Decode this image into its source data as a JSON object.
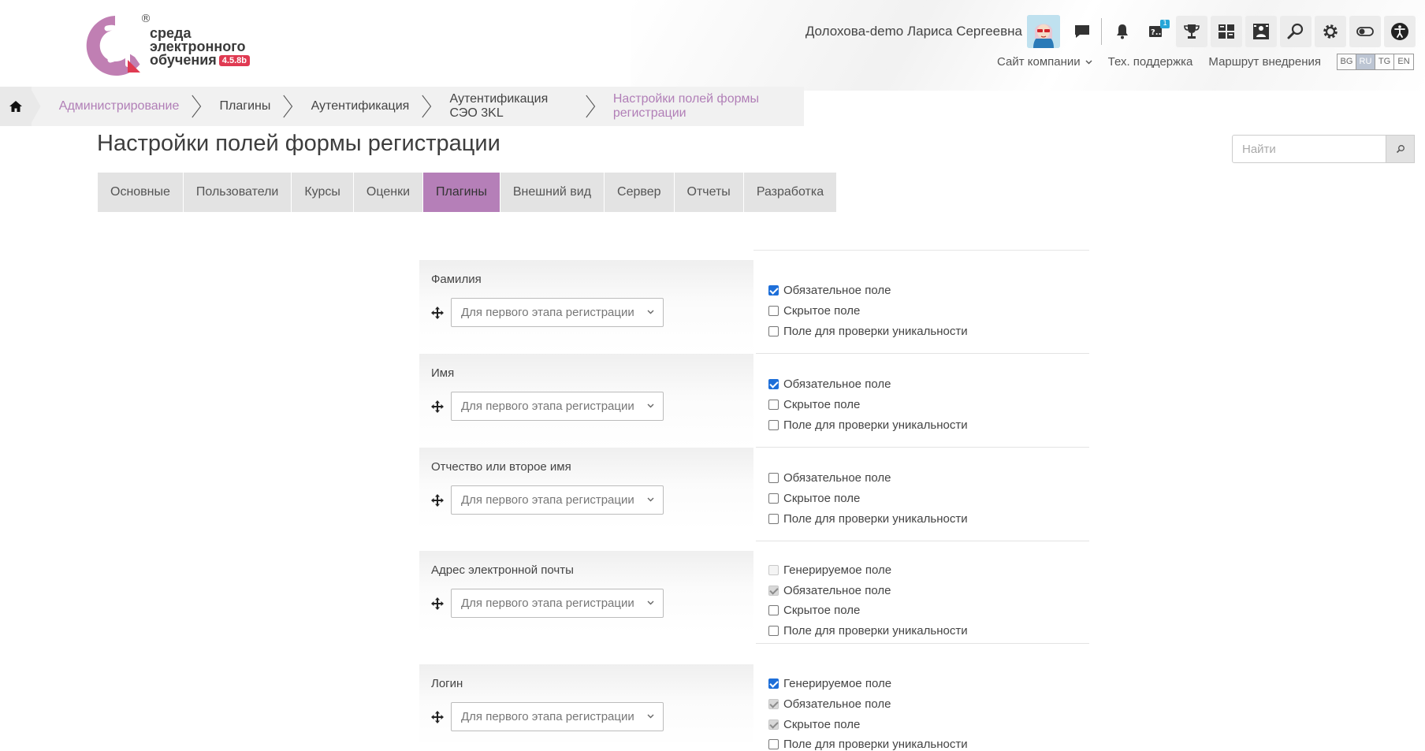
{
  "logo": {
    "line1": "среда",
    "line2": "электронного",
    "line3": "обучения",
    "version": "4.5.8b",
    "registered": "®"
  },
  "header": {
    "user_name": "Долохова-demo Лариса Сергеевна",
    "help_badge": "1",
    "links": {
      "company_site": "Сайт компании",
      "tech_support": "Тех. поддержка",
      "implementation_route": "Маршрут внедрения"
    },
    "languages": [
      "BG",
      "RU",
      "TG",
      "EN"
    ],
    "active_language": "RU"
  },
  "breadcrumb": [
    {
      "label": "Администрирование",
      "link": true
    },
    {
      "label": "Плагины",
      "link": false
    },
    {
      "label": "Аутентификация",
      "link": false
    },
    {
      "label": "Аутентификация СЭО 3KL",
      "link": false
    },
    {
      "label": "Настройки полей формы регистрации",
      "link": true
    }
  ],
  "page": {
    "title": "Настройки полей формы регистрации",
    "search_placeholder": "Найти"
  },
  "tabs": [
    {
      "label": "Основные",
      "active": false
    },
    {
      "label": "Пользователи",
      "active": false
    },
    {
      "label": "Курсы",
      "active": false
    },
    {
      "label": "Оценки",
      "active": false
    },
    {
      "label": "Плагины",
      "active": true
    },
    {
      "label": "Внешний вид",
      "active": false
    },
    {
      "label": "Сервер",
      "active": false
    },
    {
      "label": "Отчеты",
      "active": false
    },
    {
      "label": "Разработка",
      "active": false
    }
  ],
  "fields": [
    {
      "label": "Фамилия",
      "stage": "Для первого этапа регистрации",
      "options": [
        {
          "label": "Обязательное поле",
          "state": "checked"
        },
        {
          "label": "Скрытое поле",
          "state": "unchecked"
        },
        {
          "label": "Поле для проверки уникальности",
          "state": "unchecked"
        }
      ]
    },
    {
      "label": "Имя",
      "stage": "Для первого этапа регистрации",
      "options": [
        {
          "label": "Обязательное поле",
          "state": "checked"
        },
        {
          "label": "Скрытое поле",
          "state": "unchecked"
        },
        {
          "label": "Поле для проверки уникальности",
          "state": "unchecked"
        }
      ]
    },
    {
      "label": "Отчество или второе имя",
      "stage": "Для первого этапа регистрации",
      "options": [
        {
          "label": "Обязательное поле",
          "state": "unchecked"
        },
        {
          "label": "Скрытое поле",
          "state": "unchecked"
        },
        {
          "label": "Поле для проверки уникальности",
          "state": "unchecked"
        }
      ]
    },
    {
      "label": "Адрес электронной почты",
      "stage": "Для первого этапа регистрации",
      "options": [
        {
          "label": "Генерируемое поле",
          "state": "disabled"
        },
        {
          "label": "Обязательное поле",
          "state": "disabled-checked"
        },
        {
          "label": "Скрытое поле",
          "state": "unchecked"
        },
        {
          "label": "Поле для проверки уникальности",
          "state": "unchecked"
        }
      ]
    },
    {
      "label": "Логин",
      "stage": "Для первого этапа регистрации",
      "options": [
        {
          "label": "Генерируемое поле",
          "state": "checked"
        },
        {
          "label": "Обязательное поле",
          "state": "disabled-checked"
        },
        {
          "label": "Скрытое поле",
          "state": "disabled-checked"
        },
        {
          "label": "Поле для проверки уникальности",
          "state": "unchecked"
        }
      ]
    }
  ]
}
